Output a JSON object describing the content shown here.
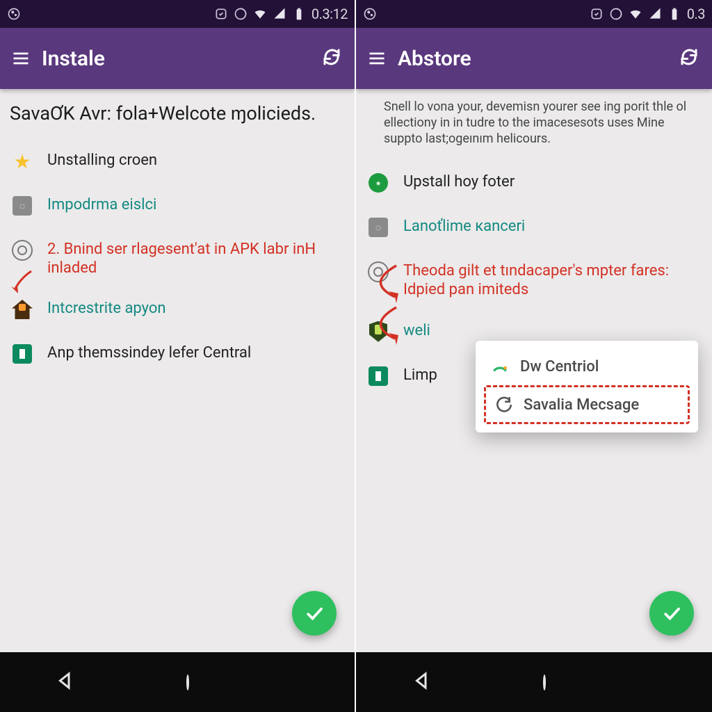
{
  "left": {
    "status_time": "0.3:12",
    "appbar_title": "Instale",
    "intro": "SavaƠK Avr: fola+Welcote ɱolicieds.",
    "items": [
      {
        "label": "Unstalling croen",
        "cls": "black"
      },
      {
        "label": "Impodrma eislci",
        "cls": "teal"
      },
      {
        "label": "2. Bnind ser rlagesent'at in APK labr inH inladed",
        "cls": "red"
      },
      {
        "label": "Intcrestrite apyon",
        "cls": "teal"
      },
      {
        "label": "Anp themssindey lefer Central",
        "cls": "black"
      }
    ]
  },
  "right": {
    "status_time": "0.3",
    "appbar_title": "Abstore",
    "intro": "Snell lo vona your, devemisn yourer see ing porit thle ol ellectiony in in tudre to the imacesesots uses Mine suppto last;ogeınım helicours.",
    "items": [
      {
        "label": "Upstall hoy foter",
        "cls": "black"
      },
      {
        "label": "Lanoťlime кanceri",
        "cls": "teal"
      },
      {
        "label": "Theoda gilt et tındacaper's mpter fares: Idpied pan imiteds",
        "cls": "red"
      },
      {
        "label": "weli",
        "cls": "teal"
      },
      {
        "label": "Limp",
        "cls": "black"
      }
    ],
    "popup": {
      "opt1": "Dw Centriol",
      "opt2": "Savalia Mecsage"
    }
  }
}
